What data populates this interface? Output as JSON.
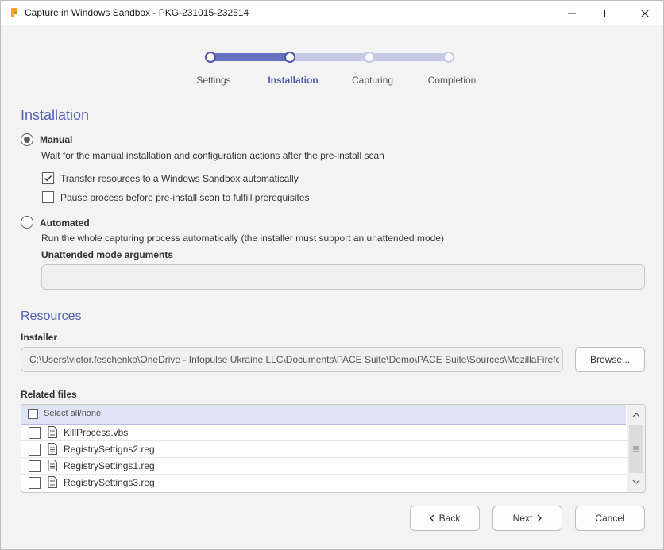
{
  "window": {
    "title": "Capture in Windows Sandbox - PKG-231015-232514",
    "icons": {
      "app": "app-logo-icon",
      "minimize": "minimize-icon",
      "maximize": "maximize-icon",
      "close": "close-icon"
    }
  },
  "stepper": {
    "steps": [
      {
        "label": "Settings",
        "state": "done"
      },
      {
        "label": "Installation",
        "state": "active"
      },
      {
        "label": "Capturing",
        "state": "pending"
      },
      {
        "label": "Completion",
        "state": "pending"
      }
    ]
  },
  "installation": {
    "title": "Installation",
    "manual": {
      "label": "Manual",
      "selected": true,
      "description": "Wait for the manual installation and configuration actions after the pre-install scan",
      "options": [
        {
          "label": "Transfer resources to a Windows Sandbox automatically",
          "checked": true
        },
        {
          "label": "Pause process before pre-install scan to fulfill prerequisites",
          "checked": false
        }
      ]
    },
    "automated": {
      "label": "Automated",
      "selected": false,
      "description": "Run the whole capturing process automatically (the installer must support an unattended mode)",
      "args_label": "Unattended mode arguments",
      "args_value": ""
    }
  },
  "resources": {
    "title": "Resources",
    "installer_label": "Installer",
    "installer_path": "C:\\Users\\victor.feschenko\\OneDrive - Infopulse Ukraine LLC\\Documents\\PACE Suite\\Demo\\PACE Suite\\Sources\\MozillaFirefox\\",
    "browse_label": "Browse...",
    "related_label": "Related files",
    "select_all_label": "Select all/none",
    "files": [
      {
        "name": "KillProcess.vbs",
        "checked": false
      },
      {
        "name": "RegistrySettigns2.reg",
        "checked": false
      },
      {
        "name": "RegistrySettings1.reg",
        "checked": false
      },
      {
        "name": "RegistrySettings3.reg",
        "checked": false
      }
    ]
  },
  "footer": {
    "back_label": "Back",
    "next_label": "Next",
    "cancel_label": "Cancel"
  },
  "colors": {
    "accent": "#5561b9",
    "stepper_fill": "#6670c0",
    "stepper_track": "#c7cae6",
    "list_header": "#e0e2f6"
  }
}
